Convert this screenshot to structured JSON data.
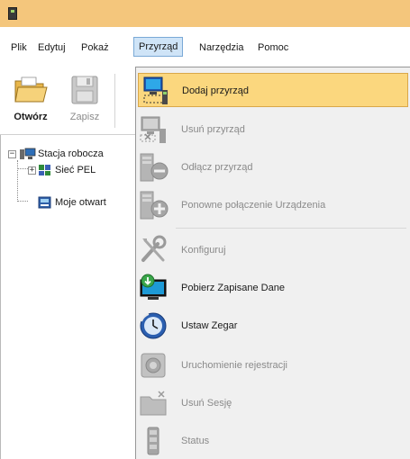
{
  "menubar": {
    "items": [
      "Plik",
      "Edytuj",
      "Pokaż",
      "Przyrząd",
      "Narzędzia",
      "Pomoc"
    ],
    "active": "Przyrząd"
  },
  "toolbar": {
    "open_label": "Otwórz",
    "save_label": "Zapisz"
  },
  "tree": {
    "root": "Stacja robocza",
    "children": [
      "Sieć PEL",
      "Moje otwart"
    ]
  },
  "dropdown": {
    "items": [
      {
        "label": "Dodaj przyrząd",
        "enabled": true,
        "highlighted": true,
        "icon": "add-instrument-icon"
      },
      {
        "label": "Usuń przyrząd",
        "enabled": false,
        "icon": "remove-instrument-icon"
      },
      {
        "label": "Odłącz przyrząd",
        "enabled": false,
        "icon": "disconnect-icon"
      },
      {
        "label": "Ponowne połączenie Urządzenia",
        "enabled": false,
        "icon": "reconnect-icon"
      },
      {
        "label": "Konfiguruj",
        "enabled": false,
        "icon": "tools-icon"
      },
      {
        "label": "Pobierz Zapisane Dane",
        "enabled": true,
        "icon": "download-data-icon"
      },
      {
        "label": "Ustaw Zegar",
        "enabled": true,
        "icon": "clock-icon"
      },
      {
        "label": "Uruchomienie rejestracji",
        "enabled": false,
        "icon": "record-icon"
      },
      {
        "label": "Usuń Sesję",
        "enabled": false,
        "icon": "delete-session-icon"
      },
      {
        "label": "Status",
        "enabled": false,
        "icon": "status-icon"
      }
    ]
  },
  "colors": {
    "titlebar": "#f4c67c",
    "highlight": "#fbd77e",
    "menu_active": "#cfe4f7",
    "disabled_text": "#8a8a8a"
  }
}
